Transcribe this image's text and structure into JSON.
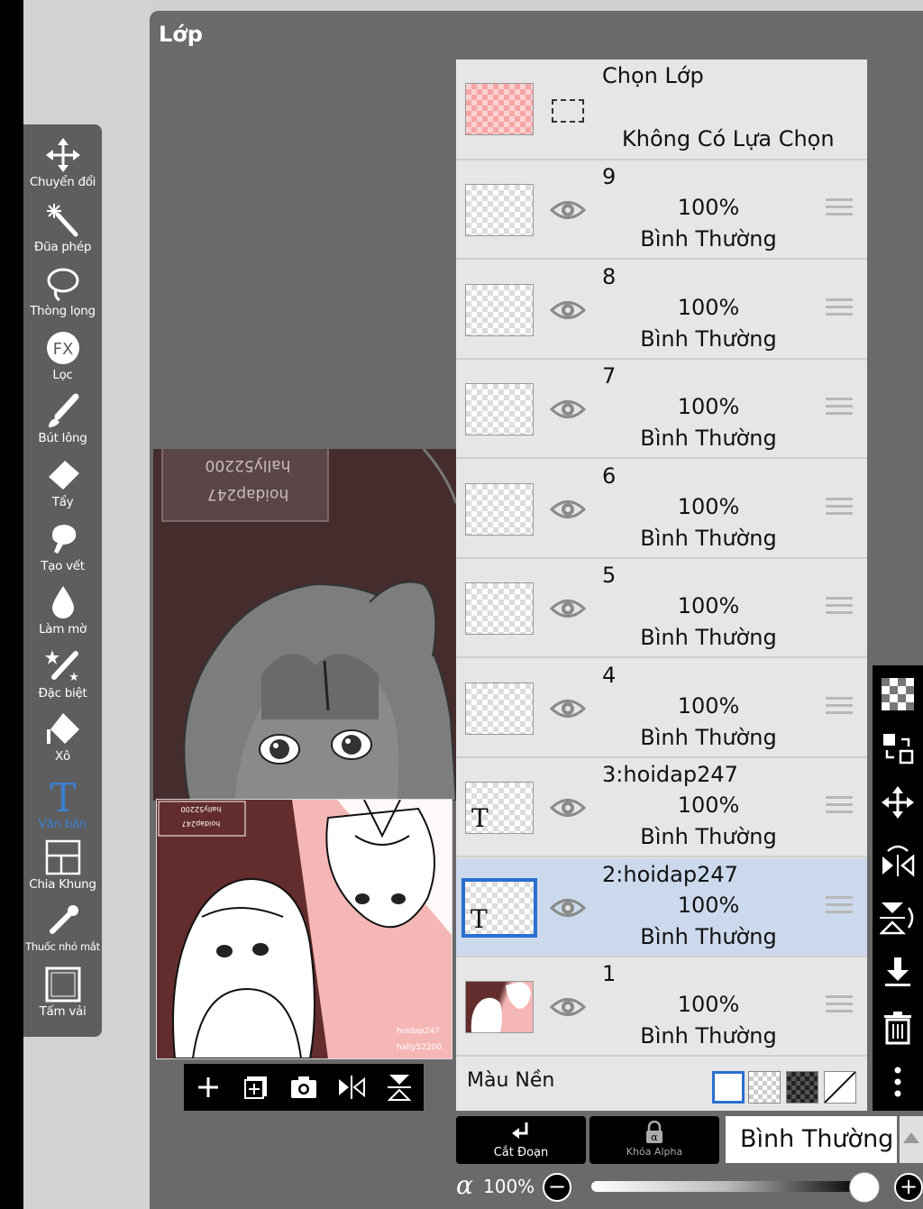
{
  "panel": {
    "title": "Lớp"
  },
  "toolbar": {
    "tools": [
      {
        "label": "Chuyển đổi",
        "icon": "move-icon"
      },
      {
        "label": "Đũa phép",
        "icon": "magic-wand-icon"
      },
      {
        "label": "Thòng lọng",
        "icon": "lasso-icon"
      },
      {
        "label": "Lọc",
        "icon": "fx-icon"
      },
      {
        "label": "Bút lông",
        "icon": "brush-icon"
      },
      {
        "label": "Tẩy",
        "icon": "eraser-icon"
      },
      {
        "label": "Tạo vết",
        "icon": "smudge-icon"
      },
      {
        "label": "Làm mờ",
        "icon": "blur-icon"
      },
      {
        "label": "Đặc biệt",
        "icon": "special-icon"
      },
      {
        "label": "Xô",
        "icon": "bucket-icon"
      },
      {
        "label": "Văn bản",
        "icon": "text-icon",
        "active": true
      },
      {
        "label": "Chia Khung",
        "icon": "frame-divider-icon"
      },
      {
        "label": "Thuốc nhỏ mắt",
        "icon": "eyedropper-icon"
      },
      {
        "label": "Tấm vải",
        "icon": "canvas-icon"
      }
    ]
  },
  "canvas": {
    "watermark_line1": "hoidap247",
    "watermark_line2": "hally52200",
    "preview_watermark_line1": "hoidap247",
    "preview_watermark_line2": "hally52200"
  },
  "selection_layer": {
    "title": "Chọn Lớp",
    "subtitle": "Không Có Lựa Chọn"
  },
  "layers": [
    {
      "name": "9",
      "opacity": "100%",
      "mode": "Bình Thường",
      "selected": false
    },
    {
      "name": "8",
      "opacity": "100%",
      "mode": "Bình Thường",
      "selected": false
    },
    {
      "name": "7",
      "opacity": "100%",
      "mode": "Bình Thường",
      "selected": false
    },
    {
      "name": "6",
      "opacity": "100%",
      "mode": "Bình Thường",
      "selected": false
    },
    {
      "name": "5",
      "opacity": "100%",
      "mode": "Bình Thường",
      "selected": false
    },
    {
      "name": "4",
      "opacity": "100%",
      "mode": "Bình Thường",
      "selected": false
    },
    {
      "name": "3:hoidap247",
      "opacity": "100%",
      "mode": "Bình Thường",
      "selected": false,
      "text_layer": true
    },
    {
      "name": "2:hoidap247",
      "opacity": "100%",
      "mode": "Bình Thường",
      "selected": true,
      "text_layer": true
    },
    {
      "name": "1",
      "opacity": "100%",
      "mode": "Bình Thường",
      "selected": false
    }
  ],
  "text_thumb_glyph": "T",
  "background": {
    "label": "Màu Nền"
  },
  "bottom": {
    "clip_label": "Cắt Đoạn",
    "alpha_lock_label": "Khóa Alpha",
    "blend_mode": "Bình Thường",
    "alpha_symbol": "α",
    "alpha_value": "100%",
    "minus": "−",
    "plus": "+"
  },
  "colors": {
    "selected_layer_bg": "#ccd9ec",
    "accent": "#2a6fcf",
    "canvas_bg": "#452d2e"
  }
}
